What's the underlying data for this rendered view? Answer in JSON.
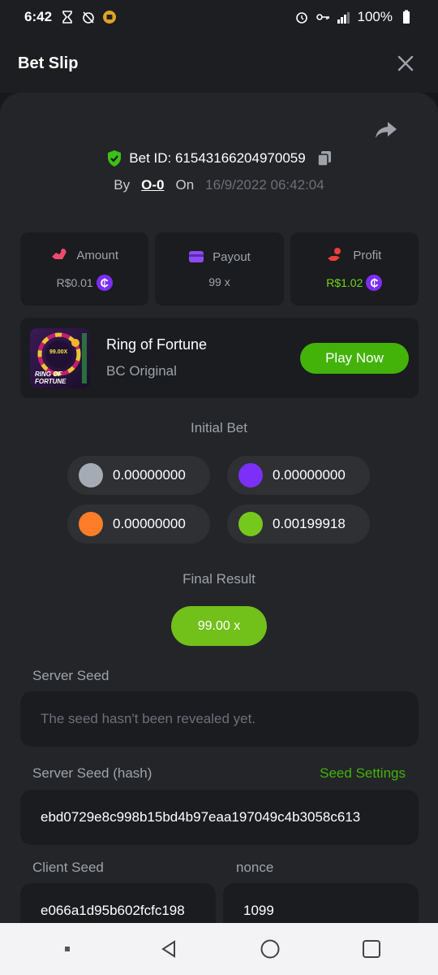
{
  "status_bar": {
    "time": "6:42",
    "battery": "100%"
  },
  "header": {
    "title": "Bet Slip"
  },
  "bet": {
    "id_label": "Bet ID: 61543166204970059",
    "by_label": "By",
    "user": "O-0",
    "on_label": "On",
    "date": "16/9/2022 06:42:04"
  },
  "stats": {
    "amount_label": "Amount",
    "amount_value": "R$0.01",
    "payout_label": "Payout",
    "payout_value": "99 x",
    "profit_label": "Profit",
    "profit_value": "R$1.02",
    "coin_symbol": "₵"
  },
  "game": {
    "name": "Ring of Fortune",
    "subtitle": "BC Original",
    "play_label": "Play Now",
    "thumb_value": "99.00X",
    "thumb_title_1": "RING OF",
    "thumb_title_2": "FORTUNE"
  },
  "initial_bet": {
    "label": "Initial Bet",
    "items": [
      {
        "value": "0.00000000",
        "color": "#a4abb4"
      },
      {
        "value": "0.00000000",
        "color": "#7b2ff7"
      },
      {
        "value": "0.00000000",
        "color": "#ff7d28"
      },
      {
        "value": "0.00199918",
        "color": "#75c91c"
      }
    ]
  },
  "final_result": {
    "label": "Final Result",
    "value": "99.00 x"
  },
  "server_seed": {
    "label": "Server Seed",
    "value": "The seed hasn't been revealed yet."
  },
  "server_seed_hash": {
    "label": "Server Seed (hash)",
    "settings_label": "Seed Settings",
    "value": "ebd0729e8c998b15bd4b97eaa197049c4b3058c613"
  },
  "client_seed": {
    "label": "Client Seed",
    "value": "e066a1d95b602fcfc198"
  },
  "nonce": {
    "label": "nonce",
    "value": "1099"
  },
  "colors": {
    "accent_green": "#43b309",
    "profit_green": "#72d61b",
    "coin_purple": "#7d2ef2",
    "panel_bg": "#232528",
    "card_bg": "#1a1c1f"
  }
}
